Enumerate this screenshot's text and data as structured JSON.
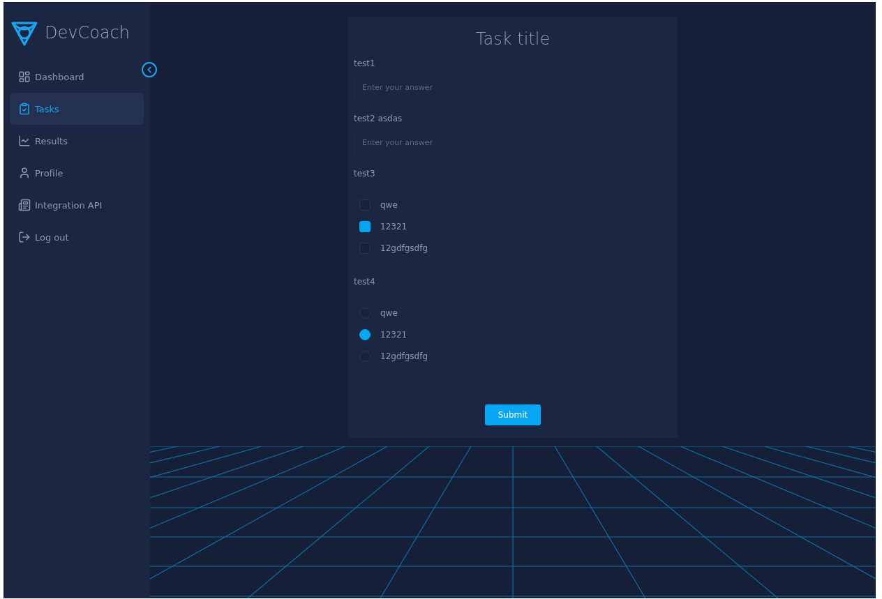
{
  "brand": {
    "name": "DevCoach"
  },
  "sidebar": {
    "items": [
      {
        "label": "Dashboard",
        "selected": false
      },
      {
        "label": "Tasks",
        "selected": true
      },
      {
        "label": "Results",
        "selected": false
      },
      {
        "label": "Profile",
        "selected": false
      },
      {
        "label": "Integration API",
        "selected": false
      },
      {
        "label": "Log out",
        "selected": false
      }
    ]
  },
  "task": {
    "title": "Task title",
    "questions": [
      {
        "kind": "text",
        "label": "test1",
        "placeholder": "Enter your answer"
      },
      {
        "kind": "text",
        "label": "test2 asdas",
        "placeholder": "Enter your answer"
      },
      {
        "kind": "checkbox",
        "label": "test3",
        "options": [
          {
            "label": "qwe",
            "selected": false
          },
          {
            "label": "12321",
            "selected": true
          },
          {
            "label": "12gdfgsdfg",
            "selected": false
          }
        ]
      },
      {
        "kind": "radio",
        "label": "test4",
        "options": [
          {
            "label": "qwe",
            "selected": false
          },
          {
            "label": "12321",
            "selected": true
          },
          {
            "label": "12gdfgsdfg",
            "selected": false
          }
        ]
      }
    ],
    "submit": "Submit"
  }
}
